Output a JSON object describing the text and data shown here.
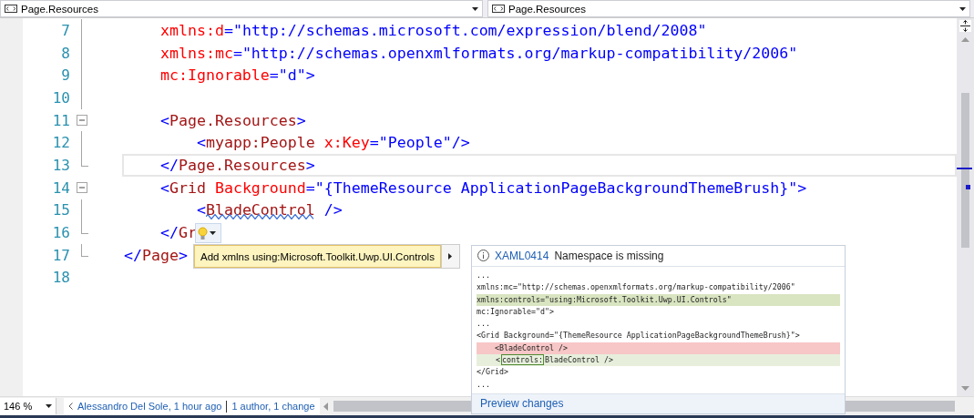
{
  "dropdowns": [
    {
      "label": "Page.Resources"
    },
    {
      "label": "Page.Resources"
    }
  ],
  "editor": {
    "lines": [
      {
        "number": "7",
        "kind": "inside",
        "current": false,
        "tokens": [
          {
            "kind": "attribute",
            "text": "    xmlns:d"
          },
          {
            "kind": "value",
            "text": "=\"http://schemas.microsoft.com/expression/blend/2008\""
          }
        ]
      },
      {
        "number": "8",
        "kind": "inside",
        "current": false,
        "tokens": [
          {
            "kind": "attribute",
            "text": "    xmlns:mc"
          },
          {
            "kind": "value",
            "text": "=\"http://schemas.openxmlformats.org/markup-compatibility/2006\""
          }
        ]
      },
      {
        "number": "9",
        "kind": "inside",
        "current": false,
        "tokens": [
          {
            "kind": "attribute",
            "text": "    mc:Ignorable"
          },
          {
            "kind": "value",
            "text": "=\"d\">"
          }
        ]
      },
      {
        "number": "10",
        "kind": "inside",
        "current": false
      },
      {
        "number": "11",
        "kind": "start",
        "current": false,
        "tokens": [
          {
            "kind": "bracket",
            "text": "    <"
          },
          {
            "kind": "element",
            "text": "Page.Resources"
          },
          {
            "kind": "bracket",
            "text": ">"
          }
        ]
      },
      {
        "number": "12",
        "kind": "inside",
        "current": false,
        "tokens": [
          {
            "kind": "bracket",
            "text": "        <"
          },
          {
            "kind": "element",
            "text": "myapp:People"
          },
          {
            "kind": "attribute",
            "text": " x:Key"
          },
          {
            "kind": "value",
            "text": "=\"People\"/>"
          }
        ]
      },
      {
        "number": "13",
        "kind": "end",
        "current": true,
        "tokens": [
          {
            "kind": "bracket",
            "text": "    </"
          },
          {
            "kind": "element",
            "text": "Page.Resources"
          },
          {
            "kind": "bracket",
            "text": ">"
          }
        ]
      },
      {
        "number": "14",
        "kind": "start",
        "current": false,
        "tokens": [
          {
            "kind": "bracket",
            "text": "    <"
          },
          {
            "kind": "element",
            "text": "Grid"
          },
          {
            "kind": "attribute",
            "text": " Background"
          },
          {
            "kind": "value",
            "text": "=\"{ThemeResource ApplicationPageBackgroundThemeBrush}\">"
          }
        ]
      },
      {
        "number": "15",
        "kind": "inside",
        "current": false,
        "tokens": [
          {
            "kind": "bracket",
            "text": "        <"
          },
          {
            "kind": "element",
            "text": "BladeControl",
            "error": true
          },
          {
            "kind": "bracket",
            "text": " />"
          }
        ]
      },
      {
        "number": "16",
        "kind": "end",
        "current": false,
        "tokens": [
          {
            "kind": "bracket",
            "text": "    </"
          },
          {
            "kind": "element",
            "text": "Gr"
          }
        ]
      },
      {
        "number": "17",
        "kind": "end",
        "current": false,
        "tokens": [
          {
            "kind": "bracket",
            "text": "</"
          },
          {
            "kind": "element",
            "text": "Page"
          },
          {
            "kind": "bracket",
            "text": ">"
          }
        ]
      },
      {
        "number": "18",
        "kind": "plain",
        "current": false
      }
    ]
  },
  "quick_actions": {
    "items": [
      {
        "label": "Add xmlns using:Microsoft.Toolkit.Uwp.UI.Controls",
        "selected": true
      }
    ]
  },
  "preview": {
    "code": "XAML0414",
    "message": "Namespace is missing",
    "lines": [
      {
        "kind": "plain",
        "text": "..."
      },
      {
        "kind": "plain",
        "text": "xmlns:mc=\"http://schemas.openxmlformats.org/markup-compatibility/2006\""
      },
      {
        "kind": "inserted",
        "text": "xmlns:controls=\"using:Microsoft.Toolkit.Uwp.UI.Controls\""
      },
      {
        "kind": "plain",
        "text": "mc:Ignorable=\"d\">"
      },
      {
        "kind": "plain",
        "text": "..."
      },
      {
        "kind": "plain",
        "text": "<Grid Background=\"{ThemeResource ApplicationPageBackgroundThemeBrush}\">"
      },
      {
        "kind": "removed",
        "text": "    <BladeControl />"
      },
      {
        "kind": "changed",
        "parts": [
          {
            "text": "    <",
            "boxed": false
          },
          {
            "text": "controls:",
            "boxed": true
          },
          {
            "text": "BladeControl />",
            "boxed": false
          }
        ]
      },
      {
        "kind": "plain",
        "text": "</Grid>"
      },
      {
        "kind": "plain",
        "text": "..."
      }
    ],
    "link": "Preview changes"
  },
  "status": {
    "zoom": "146 %",
    "author": "Alessandro Del Sole, 1 hour ago",
    "changes": "1 author, 1 change"
  }
}
